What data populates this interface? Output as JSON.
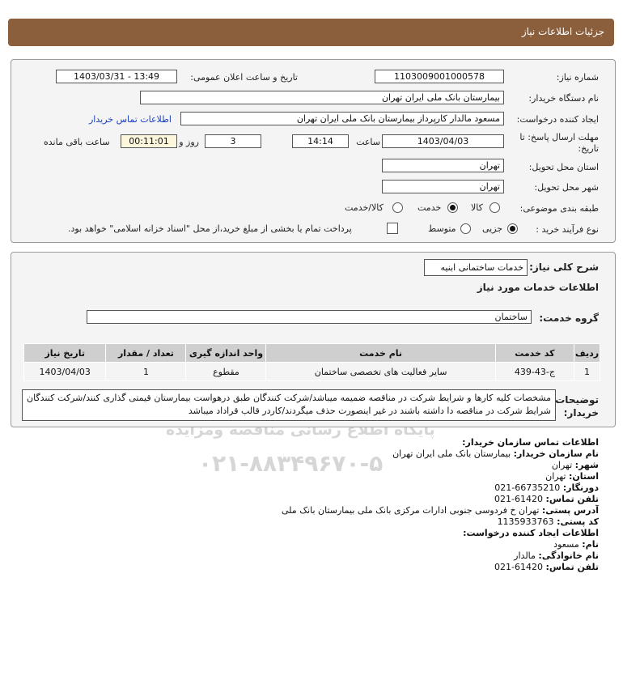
{
  "header": {
    "title": "جزئیات اطلاعات نیاز"
  },
  "form": {
    "need_number_label": "شماره نیاز:",
    "need_number": "1103009001000578",
    "announce_label": "تاریخ و ساعت اعلان عمومی:",
    "announce_value": "1403/03/31 - 13:49",
    "buyer_label": "نام دستگاه خریدار:",
    "buyer_value": "بیمارستان بانک ملی ایران تهران",
    "creator_label": "ایجاد کننده درخواست:",
    "creator_value": "مسعود مالدار کارپرداز بیمارستان بانک ملی ایران تهران",
    "contact_link": "اطلاعات تماس خریدار",
    "deadline_label_1": "مهلت ارسال پاسخ: تا",
    "deadline_label_2": "تاریخ:",
    "deadline_date": "1403/04/03",
    "time_label": "ساعت",
    "deadline_time": "14:14",
    "days_value": "3",
    "days_label": "روز و",
    "remaining_time": "00:11:01",
    "remaining_label": "ساعت باقی مانده",
    "province_label": "استان محل تحویل:",
    "province_value": "تهران",
    "city_label": "شهر محل تحویل:",
    "city_value": "تهران",
    "category_label": "طبقه بندی موضوعی:",
    "category_options": [
      "کالا",
      "خدمت",
      "کالا/خدمت"
    ],
    "category_selected": "خدمت",
    "process_label": "نوع فرآیند خرید :",
    "process_options": [
      "جزیی",
      "متوسط"
    ],
    "process_selected": "جزیی",
    "payment_note": "پرداخت تمام یا بخشی از مبلغ خرید،از محل \"اسناد خزانه اسلامی\" خواهد بود."
  },
  "details": {
    "summary_label": "شرح کلی نیاز:",
    "summary_value": "خدمات ساختمانی ابنیه",
    "services_heading": "اطلاعات خدمات مورد نیاز",
    "group_label": "گروه خدمت:",
    "group_value": "ساختمان",
    "table": {
      "headers": [
        "ردیف",
        "کد خدمت",
        "نام خدمت",
        "واحد اندازه گیری",
        "تعداد / مقدار",
        "تاریخ نیاز"
      ],
      "rows": [
        [
          "1",
          "ج-43-439",
          "سایر فعالیت های تخصصی ساختمان",
          "مقطوع",
          "1",
          "1403/04/03"
        ]
      ]
    },
    "notes_label_1": "توضیحات",
    "notes_label_2": "خریدار:",
    "notes_text": "مشخصات کلیه کارها و شرایط شرکت در مناقصه ضمیمه میباشد/شرکت کنندگان طبق درهواست بیمارستان قیمتی گذاری کنند/شرکت کنندگان شرایط شرکت در مناقصه دا داشته باشند در غیر اینصورت حذف میگردند/کاردر قالب قراداد میباشد"
  },
  "contact": {
    "org_heading": "اطلاعات تماس سازمان خریدار:",
    "org_name_label": "نام سازمان خریدار:",
    "org_name": "بیمارستان بانک ملی ایران تهران",
    "city_label": "شهر:",
    "city": "تهران",
    "province_label": "استان:",
    "province": "تهران",
    "fax_label": "دورنگار:",
    "fax": "66735210-021",
    "phone_label": "تلفن تماس:",
    "phone": "61420-021",
    "address_label": "آدرس پستی:",
    "address": "تهران خ فردوسی جنوبی ادارات مرکزی بانک ملی بیمارستان بانک ملی",
    "postal_label": "کد پستی:",
    "postal": "1135933763",
    "creator_heading": "اطلاعات ایجاد کننده درخواست:",
    "first_name_label": "نام:",
    "first_name": "مسعود",
    "last_name_label": "نام خانوادگی:",
    "last_name": "مالدار",
    "creator_phone_label": "تلفن تماس:",
    "creator_phone": "61420-021"
  },
  "watermark": {
    "brand": "ParsNamadData",
    "persian": "پایگاه اطلاع رسانی مناقصه ومزایده",
    "phone": "۰۲۱-۸۸۳۴۹۶۷۰-۵"
  }
}
